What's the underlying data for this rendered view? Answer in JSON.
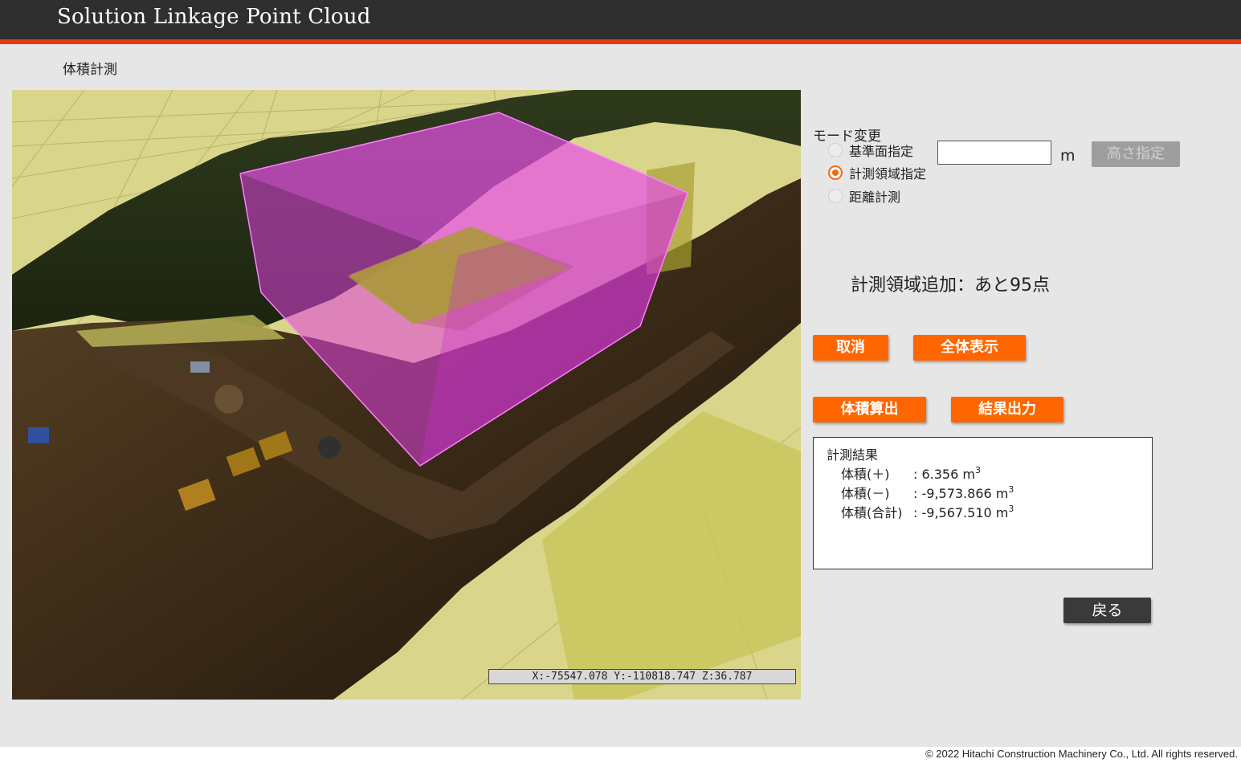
{
  "header": {
    "title": "Solution Linkage Point Cloud"
  },
  "page": {
    "title": "体積計測"
  },
  "viewer": {
    "coord_readout": "X:-75547.078 Y:-110818.747 Z:36.787"
  },
  "mode": {
    "label": "モード変更",
    "options": [
      {
        "label": "基準面指定",
        "checked": false
      },
      {
        "label": "計測領域指定",
        "checked": true
      },
      {
        "label": "距離計測",
        "checked": false
      }
    ],
    "height_value": "",
    "unit": "m",
    "height_button": "高さ指定"
  },
  "status": {
    "text": "計測領域追加：あと95点"
  },
  "buttons": {
    "cancel": "取消",
    "show_all": "全体表示",
    "calc_volume": "体積算出",
    "export": "結果出力",
    "back": "戻る"
  },
  "result": {
    "title": "計測結果",
    "rows": [
      {
        "label": "体積(＋)",
        "value": ": 6.356 m",
        "exp": "3"
      },
      {
        "label": "体積(－)",
        "value": ": -9,573.866 m",
        "exp": "3"
      },
      {
        "label": "体積(合計)",
        "value": ": -9,567.510 m",
        "exp": "3"
      }
    ]
  },
  "colors": {
    "accent": "#ff6600",
    "header_bg": "#2f2f2f",
    "header_rule": "#e23b12",
    "volume_box": "#e040e0"
  },
  "footer": {
    "copyright": "© 2022 Hitachi Construction Machinery Co., Ltd. All rights reserved."
  }
}
